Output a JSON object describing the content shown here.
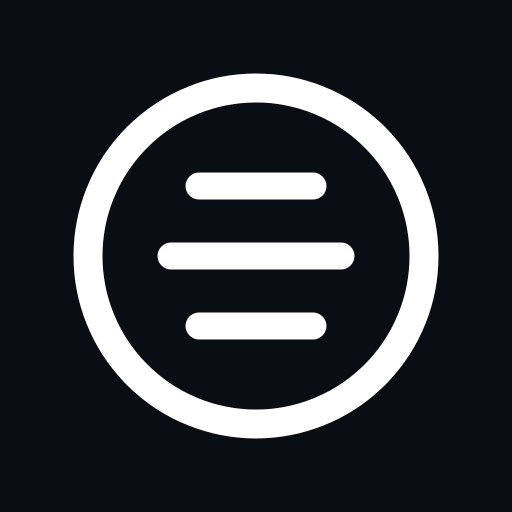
{
  "icon": {
    "name": "circled-menu-icon",
    "background_color": "#0b0d14",
    "foreground_color": "#ffffff"
  }
}
